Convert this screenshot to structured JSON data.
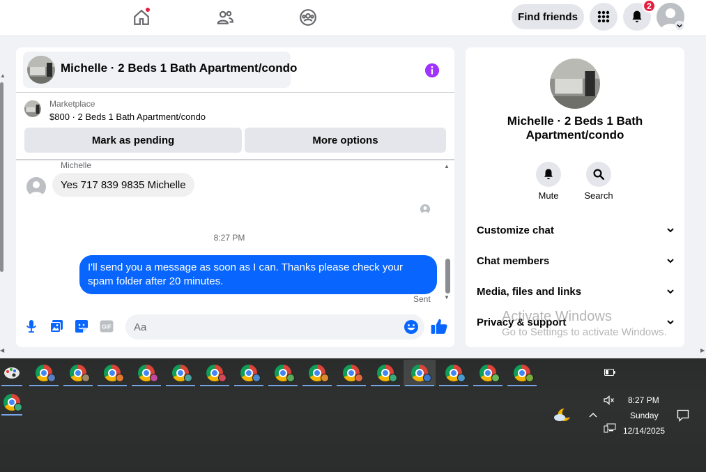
{
  "topnav": {
    "notifications_count": "2",
    "find_friends_label": "Find friends"
  },
  "chat": {
    "title": "Michelle · 2 Beds 1 Bath Apartment/condo",
    "marketplace": {
      "label": "Marketplace",
      "listing": "$800 · 2 Beds 1 Bath Apartment/condo"
    },
    "actions": {
      "mark_pending": "Mark as pending",
      "more_options": "More options"
    },
    "messages": {
      "incoming_sender": "Michelle",
      "incoming_text": "Yes 717 839 9835 Michelle",
      "timestamp": "8:27 PM",
      "outgoing_text": "I'll send you a message as soon as I can. Thanks please check your spam folder after 20 minutes.",
      "status": "Sent"
    },
    "composer": {
      "placeholder": "Aa"
    },
    "accent_color": "#0866ff"
  },
  "info_panel": {
    "title": "Michelle · 2 Beds 1 Bath Apartment/condo",
    "buttons": [
      {
        "label": "Mute",
        "icon": "bell-icon"
      },
      {
        "label": "Search",
        "icon": "search-icon"
      }
    ],
    "sections": [
      {
        "label": "Customize chat"
      },
      {
        "label": "Chat members"
      },
      {
        "label": "Media, files and links"
      },
      {
        "label": "Privacy & support"
      }
    ]
  },
  "watermark": {
    "line1": "Activate Windows",
    "line2": "Go to Settings to activate Windows."
  },
  "taskbar": {
    "time": "8:27 PM",
    "day": "Sunday",
    "date": "12/14/2025"
  }
}
